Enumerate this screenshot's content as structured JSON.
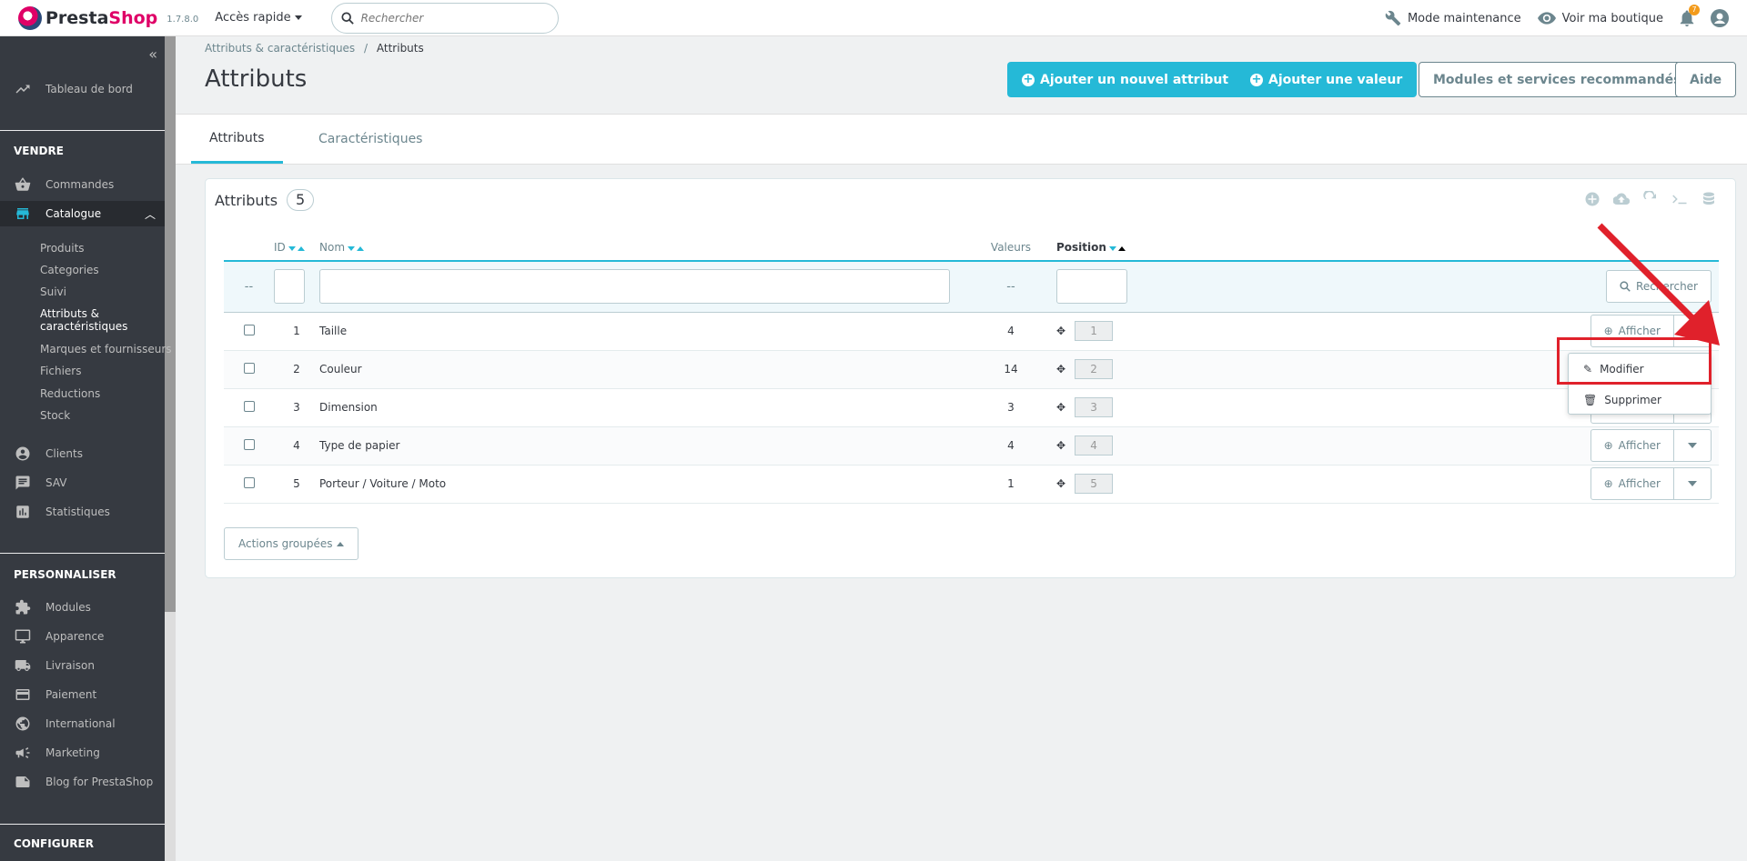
{
  "header": {
    "logo_text_a": "Presta",
    "logo_text_b": "Shop",
    "version": "1.7.8.0",
    "quick_access": "Accès rapide",
    "search_placeholder": "Rechercher",
    "maintenance": "Mode maintenance",
    "view_shop": "Voir ma boutique",
    "notifications_count": "7"
  },
  "sidebar": {
    "dashboard": "Tableau de bord",
    "sell_section": "VENDRE",
    "orders": "Commandes",
    "catalog": "Catalogue",
    "catalog_sub": [
      "Produits",
      "Categories",
      "Suivi",
      "Attributs &",
      "caractéristiques",
      "Marques et fournisseurs",
      "Fichiers",
      "Reductions",
      "Stock"
    ],
    "customers": "Clients",
    "service": "SAV",
    "stats": "Statistiques",
    "customize_section": "PERSONNALISER",
    "modules": "Modules",
    "appearance": "Apparence",
    "shipping": "Livraison",
    "payment": "Paiement",
    "international": "International",
    "marketing": "Marketing",
    "blog": "Blog for PrestaShop",
    "configure_section": "CONFIGURER"
  },
  "page": {
    "breadcrumb_parent": "Attributs & caractéristiques",
    "breadcrumb_sep": "/",
    "breadcrumb_current": "Attributs",
    "title": "Attributs",
    "btn_add_attribute": "Ajouter un nouvel attribut",
    "btn_add_value": "Ajouter une valeur",
    "btn_modules": "Modules et services recommandés",
    "btn_help": "Aide"
  },
  "tabs": [
    "Attributs",
    "Caractéristiques"
  ],
  "panel": {
    "title": "Attributs",
    "count": "5",
    "columns": {
      "id": "ID",
      "name": "Nom",
      "values": "Valeurs",
      "position": "Position"
    },
    "filter_dash_a": "--",
    "filter_dash_b": "--",
    "search_btn": "Rechercher",
    "rows": [
      {
        "id": "1",
        "name": "Taille",
        "values": "4",
        "position": "1"
      },
      {
        "id": "2",
        "name": "Couleur",
        "values": "14",
        "position": "2"
      },
      {
        "id": "3",
        "name": "Dimension",
        "values": "3",
        "position": "3"
      },
      {
        "id": "4",
        "name": "Type de papier",
        "values": "4",
        "position": "4"
      },
      {
        "id": "5",
        "name": "Porteur / Voiture / Moto",
        "values": "1",
        "position": "5"
      }
    ],
    "view_btn": "Afficher",
    "bulk_actions": "Actions groupées"
  },
  "dropdown": {
    "edit": "Modifier",
    "delete": "Supprimer"
  },
  "colors": {
    "accent": "#25b9d7",
    "sidebar_bg": "#363a41",
    "highlight": "#e0212b",
    "brand_pink": "#df0067"
  }
}
